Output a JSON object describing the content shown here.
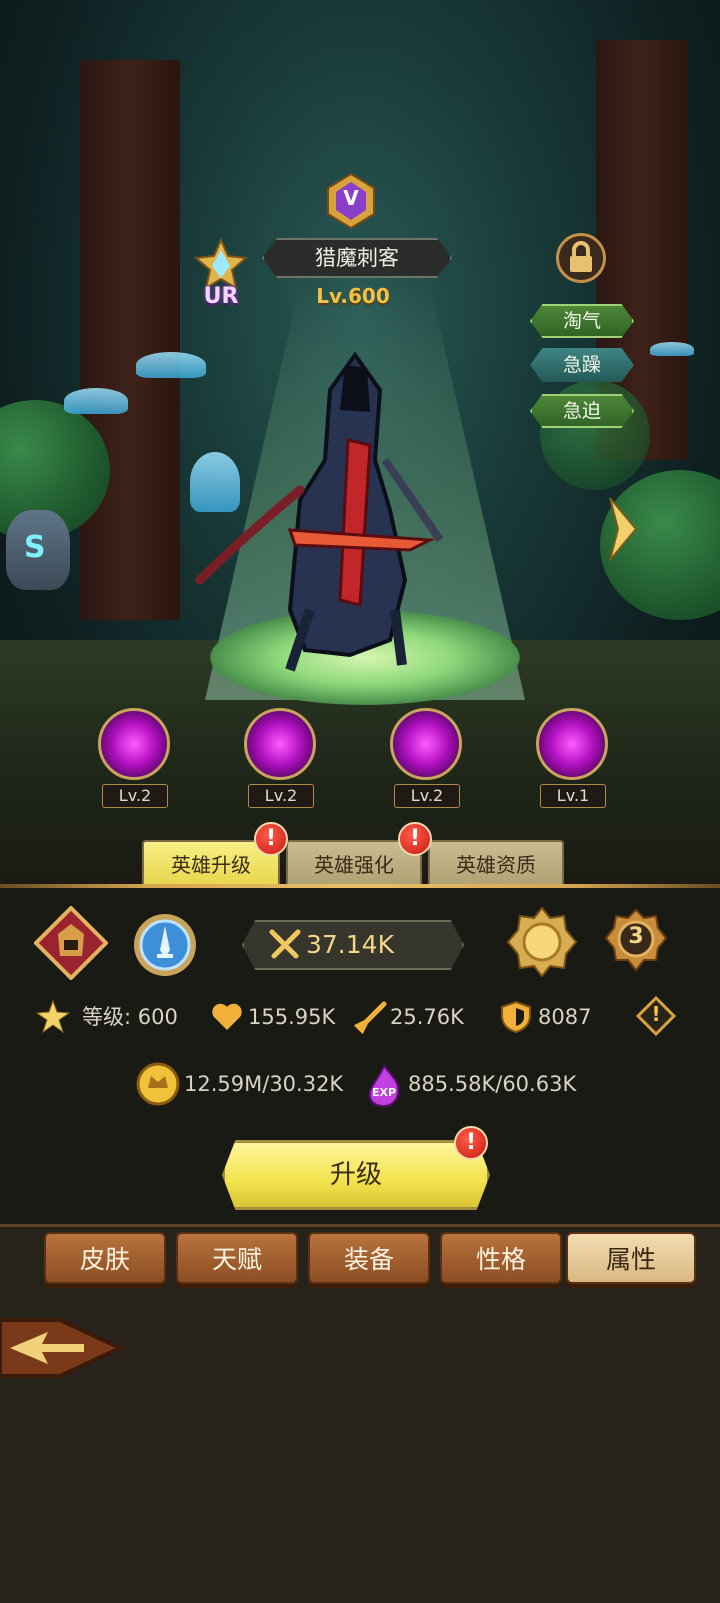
{
  "hero": {
    "rank_badge": "V",
    "rarity": "UR",
    "name": "猎魔刺客",
    "level": "Lv.600",
    "traits": [
      "淘气",
      "急躁",
      "急迫"
    ],
    "rune_glyph": "S"
  },
  "skills": [
    {
      "icon": "fist-skill-icon",
      "level": "Lv.2"
    },
    {
      "icon": "slash-skill-icon",
      "level": "Lv.2"
    },
    {
      "icon": "dash-strike-skill-icon",
      "level": "Lv.2"
    },
    {
      "icon": "blade-burst-skill-icon",
      "level": "Lv.1"
    }
  ],
  "tabs": [
    "英雄升级",
    "英雄强化",
    "英雄资质"
  ],
  "tab_alerts": [
    "!",
    "!"
  ],
  "power": "37.14K",
  "badge_number": "3",
  "stats": {
    "level_label": "等级: 600",
    "hp": "155.95K",
    "attack": "25.76K",
    "defense": "8087",
    "info": "!"
  },
  "resources": {
    "gold": "12.59M/30.32K",
    "exp_icon": "EXP",
    "exp": "885.58K/60.63K"
  },
  "upgrade": {
    "label": "升级",
    "alert": "!"
  },
  "bottom_nav": [
    "皮肤",
    "天赋",
    "装备",
    "性格",
    "属性"
  ],
  "active_nav": "属性",
  "colors": {
    "accent_gold": "#f3c046",
    "button_yellow": "#f2e24c",
    "alert_red": "#c81b12"
  }
}
